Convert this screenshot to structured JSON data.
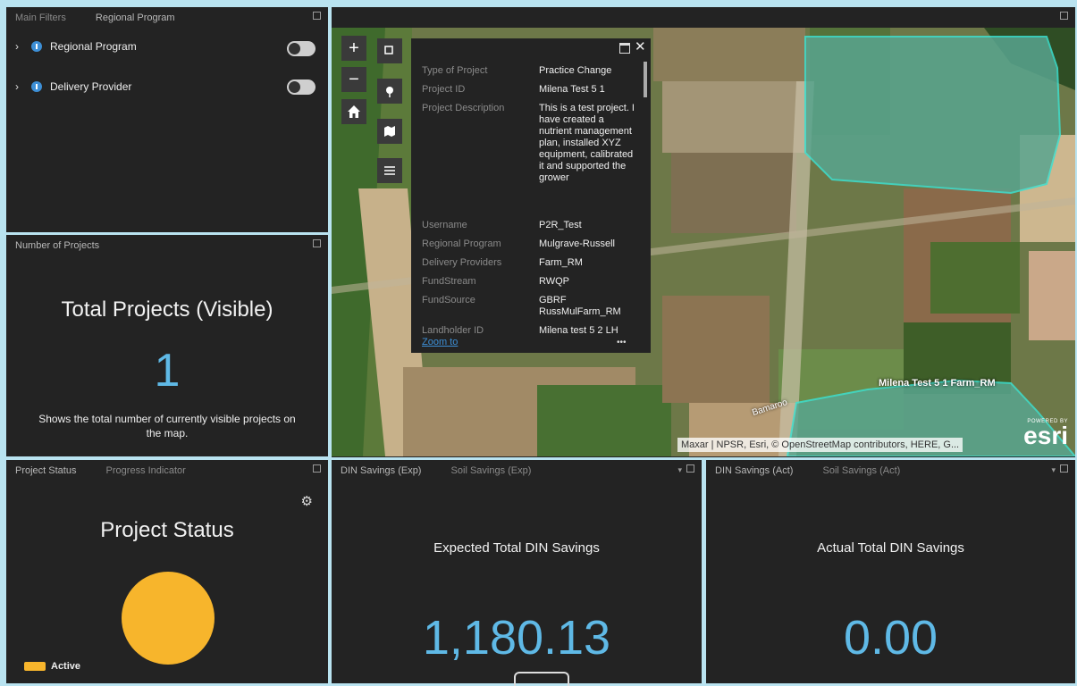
{
  "filters_panel": {
    "tabs": [
      "Main Filters",
      "Regional Program"
    ],
    "items": [
      {
        "label": "Regional Program"
      },
      {
        "label": "Delivery Provider"
      }
    ]
  },
  "projects_panel": {
    "tab": "Number of Projects",
    "title": "Total Projects (Visible)",
    "value": "1",
    "description": "Shows the total number of currently visible projects on the map."
  },
  "map": {
    "popup": {
      "rows": [
        {
          "label": "Type of Project",
          "value": "Practice Change"
        },
        {
          "label": "Project ID",
          "value": "Milena Test 5 1"
        },
        {
          "label": "Project Description",
          "value": "This is a test project. I have created a nutrient management plan, installed XYZ equipment, calibrated it and supported the grower"
        },
        {
          "label": "Username",
          "value": "P2R_Test"
        },
        {
          "label": "Regional Program",
          "value": "Mulgrave-Russell"
        },
        {
          "label": "Delivery Providers",
          "value": "Farm_RM"
        },
        {
          "label": "FundStream",
          "value": "RWQP"
        },
        {
          "label": "FundSource",
          "value": "GBRF RussMulFarm_RM"
        },
        {
          "label": "Landholder ID",
          "value": "Milena test 5 2 LH"
        }
      ],
      "zoom_link": "Zoom to",
      "more": "•••"
    },
    "map_labels": {
      "farm": "Milena Test 5 1 Farm_RM",
      "road": "Bamaroo"
    },
    "attribution": "Maxar | NPSR, Esri, © OpenStreetMap contributors, HERE, G...",
    "esri_powered": "POWERED BY",
    "esri_logo": "esri"
  },
  "status_panel": {
    "tabs": [
      "Project Status",
      "Progress Indicator"
    ],
    "title": "Project Status",
    "pie_value": 1,
    "legend": [
      {
        "label": "Active",
        "color": "#f7b52c"
      }
    ]
  },
  "din_exp_panel": {
    "tabs": [
      "DIN Savings (Exp)",
      "Soil Savings (Exp)"
    ],
    "title": "Expected Total DIN Savings",
    "value": "1,180.13"
  },
  "din_act_panel": {
    "tabs": [
      "DIN Savings (Act)",
      "Soil Savings (Act)"
    ],
    "title": "Actual Total DIN Savings",
    "value": "0.00"
  },
  "colors": {
    "accent": "#5fb9e6",
    "panel": "#232323",
    "active": "#f7b52c",
    "polygon": "#3de0d0"
  }
}
